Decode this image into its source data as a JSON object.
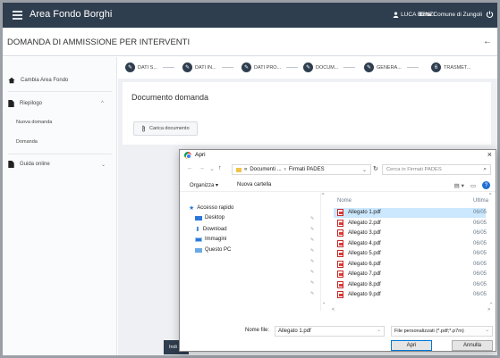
{
  "app": {
    "title": "Area Fondo Borghi",
    "user": "LUCA BENZI",
    "ente_label": "Ente",
    "ente_value": "Comune di Zungoli"
  },
  "page": {
    "title": "DOMANDA DI AMMISSIONE PER INTERVENTI"
  },
  "sidebar": {
    "items": [
      {
        "label": "Cambia Area Fondo"
      },
      {
        "label": "Riepilogo"
      },
      {
        "label": "Nuova domanda"
      },
      {
        "label": "Domanda"
      },
      {
        "label": "Guida online"
      }
    ]
  },
  "steps": [
    {
      "label": "DATI S...",
      "marker": "✎"
    },
    {
      "label": "DATI IN...",
      "marker": "✎"
    },
    {
      "label": "DATI PRO...",
      "marker": "✎"
    },
    {
      "label": "DOCUM...",
      "marker": "✎"
    },
    {
      "label": "GENERA...",
      "marker": "✎"
    },
    {
      "label": "TRASMET...",
      "marker": "6"
    }
  ],
  "card": {
    "title": "Documento domanda",
    "upload_label": "Carica documento"
  },
  "footer": {
    "button_label": "Indi"
  },
  "dialog": {
    "title": "Apri",
    "path": [
      "Documenti ...",
      "Firmati PADES"
    ],
    "search_placeholder": "Cerca in Firmati PADES",
    "organize_label": "Organizza ▾",
    "new_folder_label": "Nuova cartella",
    "nav": [
      {
        "label": "Accesso rapido",
        "icon": "star-icon"
      },
      {
        "label": "Desktop",
        "icon": "desktop-icon"
      },
      {
        "label": "Download",
        "icon": "download-icon"
      },
      {
        "label": "Immagini",
        "icon": "images-icon"
      },
      {
        "label": "Questo PC",
        "icon": "pc-icon"
      }
    ],
    "columns": {
      "name": "Nome",
      "modified": "Ultima"
    },
    "files": [
      {
        "name": "Allegato 1.pdf",
        "date": "06/05",
        "selected": true
      },
      {
        "name": "Allegato 2.pdf",
        "date": "06/05",
        "selected": false
      },
      {
        "name": "Allegato 3.pdf",
        "date": "06/05",
        "selected": false
      },
      {
        "name": "Allegato 4.pdf",
        "date": "06/05",
        "selected": false
      },
      {
        "name": "Allegato 5.pdf",
        "date": "06/05",
        "selected": false
      },
      {
        "name": "Allegato 6.pdf",
        "date": "06/05",
        "selected": false
      },
      {
        "name": "Allegato 7.pdf",
        "date": "06/05",
        "selected": false
      },
      {
        "name": "Allegato 8.pdf",
        "date": "06/05",
        "selected": false
      },
      {
        "name": "Allegato 9.pdf",
        "date": "06/05",
        "selected": false
      }
    ],
    "filename_label": "Nome file:",
    "filename_value": "Allegato 1.pdf",
    "filetype_value": "File personalizzati (*.pdf;*.p7m)",
    "open_label": "Apri",
    "cancel_label": "Annulla"
  }
}
